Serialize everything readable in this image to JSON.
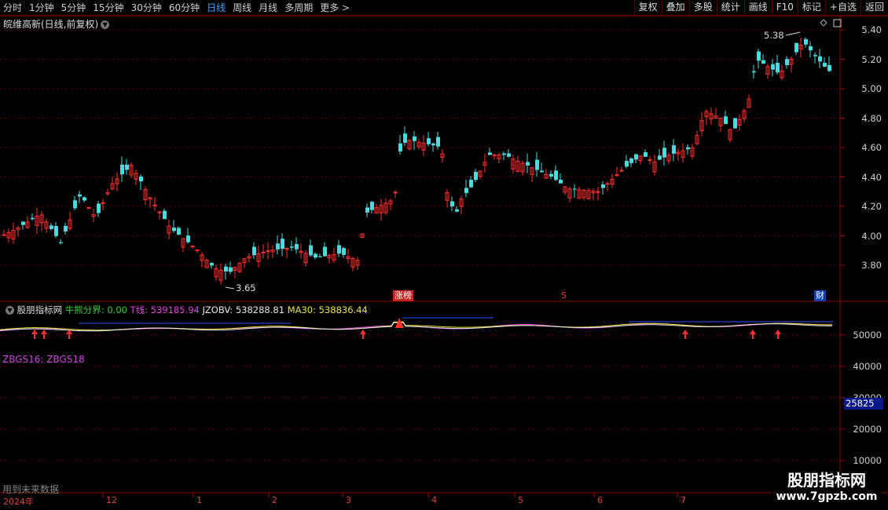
{
  "toolbar": {
    "periods": [
      "分时",
      "1分钟",
      "5分钟",
      "15分钟",
      "30分钟",
      "60分钟",
      "日线",
      "周线",
      "月线",
      "多周期",
      "更多 >"
    ],
    "active": "日线",
    "actions": [
      "复权",
      "叠加",
      "多股",
      "统计",
      "画线",
      "F10",
      "标记",
      "+自选",
      "返回"
    ]
  },
  "stock_title": "皖维高新(日线,前复权)",
  "price_axis": [
    "5.40",
    "5.20",
    "5.00",
    "4.80",
    "4.60",
    "4.40",
    "4.20",
    "4.00",
    "3.80"
  ],
  "high_label": "5.38",
  "low_label": "3.65",
  "tags": {
    "zhangbang": "涨榜",
    "s": "S",
    "cai": "财"
  },
  "sub": {
    "name": "股朋指标网",
    "items": [
      {
        "label": "牛熊分界: 0.00",
        "color": "#35d035"
      },
      {
        "label": "T线: 539185.94",
        "color": "#e040e0"
      },
      {
        "label": "JZOBV: 538288.81",
        "color": "#e8e8e8"
      },
      {
        "label": "MA30: 538836.44",
        "color": "#e8e83a"
      }
    ],
    "zbgs": "ZBGS16: ZBGS18",
    "axis": [
      "50000",
      "40000",
      "30000",
      "20000",
      "10000"
    ],
    "current": "25825"
  },
  "future_text": "用到未来数据",
  "x_axis": [
    "2024年",
    "12",
    "1",
    "2",
    "3",
    "4",
    "5",
    "6",
    "7"
  ],
  "watermark": {
    "name": "股朋指标网",
    "url": "www.7gpzb.com"
  },
  "colors": {
    "up": "#ff3030",
    "down": "#40e0e0",
    "grid": "#6a0000",
    "text": "#d0d0d0"
  }
}
